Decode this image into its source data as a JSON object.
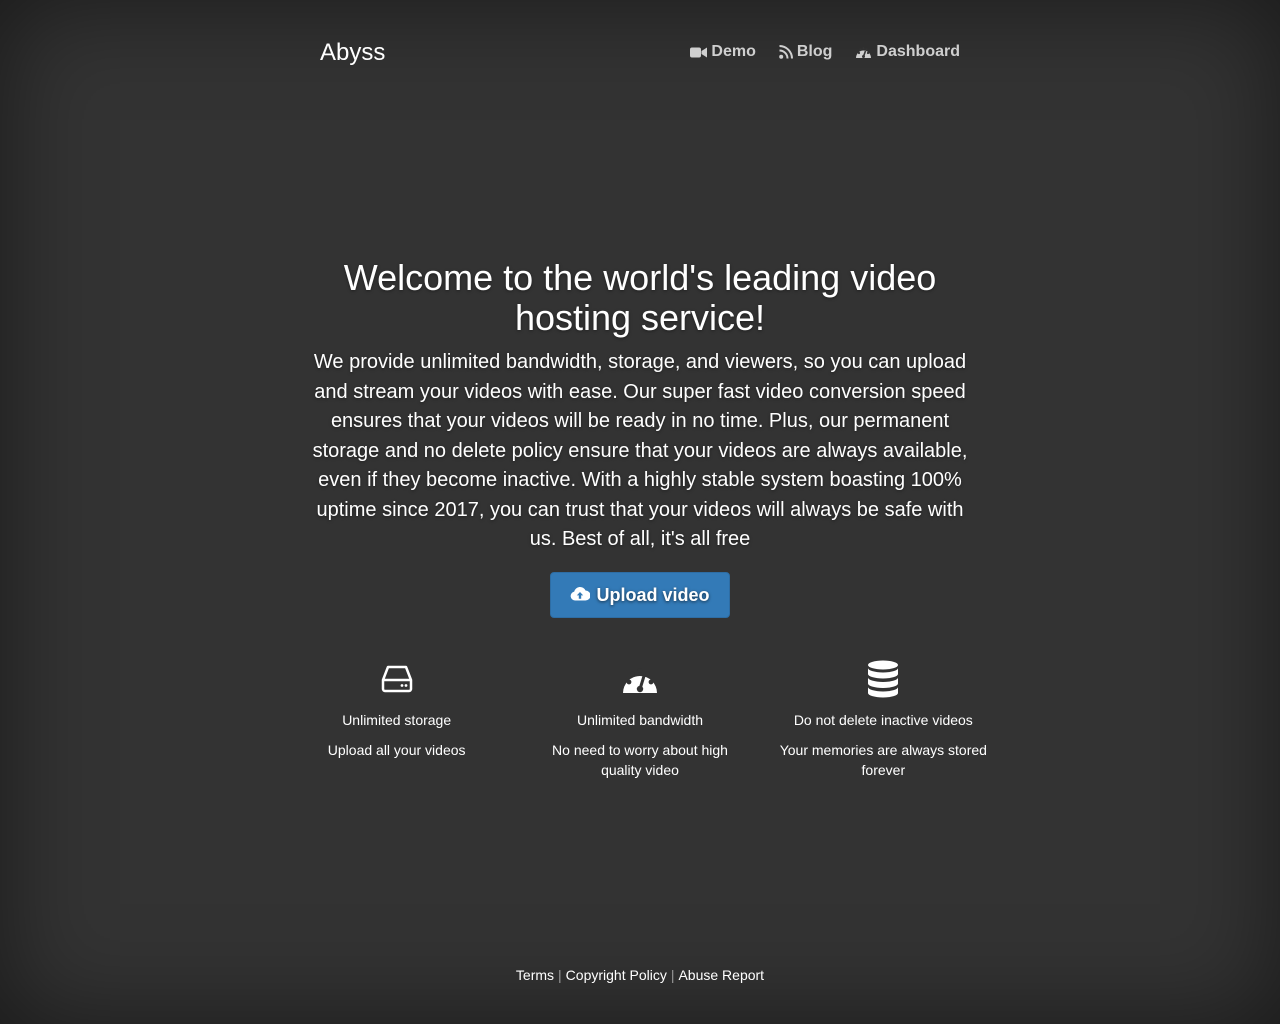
{
  "header": {
    "brand": "Abyss",
    "nav": [
      {
        "label": "Demo",
        "icon": "video-camera-icon"
      },
      {
        "label": "Blog",
        "icon": "rss-icon"
      },
      {
        "label": "Dashboard",
        "icon": "dashboard-icon"
      }
    ]
  },
  "hero": {
    "title": "Welcome to the world's leading video hosting service!",
    "text": "We provide unlimited bandwidth, storage, and viewers, so you can upload and stream your videos with ease. Our super fast video conversion speed ensures that your videos will be ready in no time. Plus, our permanent storage and no delete policy ensure that your videos are always available, even if they become inactive. With a highly stable system boasting 100% uptime since 2017, you can trust that your videos will always be safe with us. Best of all, it's all free",
    "upload_label": "Upload video",
    "upload_icon": "cloud-upload-icon"
  },
  "features": [
    {
      "icon": "hard-drive-icon",
      "title": "Unlimited storage",
      "desc": "Upload all your videos"
    },
    {
      "icon": "dashboard-icon",
      "title": "Unlimited bandwidth",
      "desc": "No need to worry about high quality video"
    },
    {
      "icon": "database-icon",
      "title": "Do not delete inactive videos",
      "desc": "Your memories are always stored forever"
    }
  ],
  "footer": {
    "links": [
      "Terms",
      "Copyright Policy",
      "Abuse Report"
    ]
  },
  "colors": {
    "background": "#333333",
    "accent": "#337ab7",
    "nav_text": "#cfcfcf"
  }
}
